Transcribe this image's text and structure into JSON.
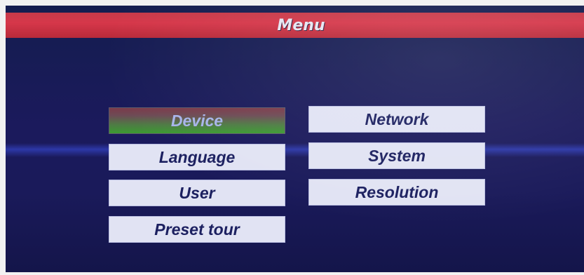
{
  "window": {
    "title": "Menu"
  },
  "colors": {
    "background": "#1b1a5c",
    "title_bar": "#d6374a",
    "button": "#e1e3f3",
    "button_text": "#1c2060",
    "selected_start": "#7b3a4a",
    "selected_end": "#3c9a32"
  },
  "menu": {
    "selected": "Device",
    "left_column": [
      {
        "label": "Device"
      },
      {
        "label": "Language"
      },
      {
        "label": "User"
      },
      {
        "label": "Preset tour"
      }
    ],
    "right_column": [
      {
        "label": "Network"
      },
      {
        "label": "System"
      },
      {
        "label": "Resolution"
      }
    ]
  }
}
